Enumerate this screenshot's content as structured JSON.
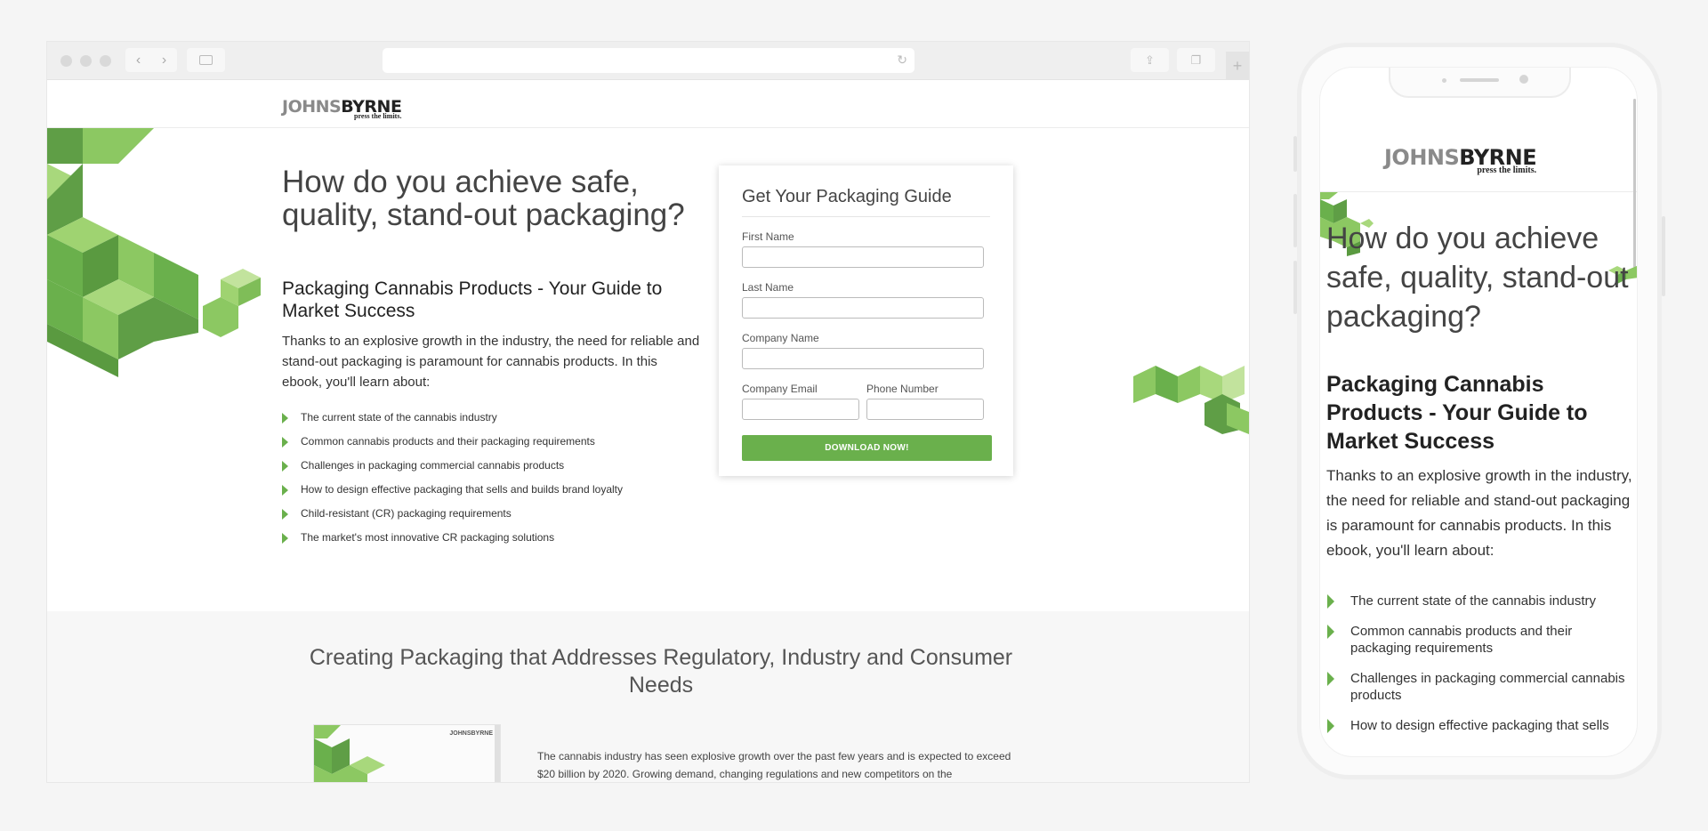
{
  "brand": {
    "name_part1": "JOHNS",
    "name_part2": "BYRNE",
    "tagline": "press the limits.",
    "accent": "#6ab04c"
  },
  "browser_icons": {
    "back": "chevron-left-icon",
    "forward": "chevron-right-icon",
    "sidebar": "sidebar-icon",
    "reload": "reload-icon",
    "share": "share-icon",
    "tabs": "tabs-icon",
    "new_tab": "plus-icon"
  },
  "hero": {
    "headline": "How do you achieve safe, quality, stand-out packaging?",
    "subheadline": "Packaging Cannabis Products - Your Guide to Market Success",
    "intro": "Thanks to an explosive growth in the industry, the need for reliable and stand-out packaging is paramount for cannabis products. In this ebook, you'll learn about:",
    "bullets": [
      "The current state of the cannabis industry",
      "Common cannabis products and their packaging requirements",
      "Challenges in packaging commercial cannabis products",
      "How to design effective packaging that sells and builds brand loyalty",
      "Child-resistant (CR) packaging requirements",
      "The market's most innovative CR packaging solutions"
    ]
  },
  "form": {
    "title": "Get Your Packaging Guide",
    "first_name_label": "First Name",
    "last_name_label": "Last Name",
    "company_name_label": "Company Name",
    "company_email_label": "Company Email",
    "phone_label": "Phone Number",
    "submit_label": "DOWNLOAD NOW!"
  },
  "section2": {
    "title": "Creating Packaging that Addresses Regulatory, Industry and Consumer Needs",
    "paragraph": "The cannabis industry has seen explosive growth over the past few years and is expected to exceed $20 billion by 2020. Growing demand, changing regulations and new competitors on the",
    "book_logo": "JOHNSBYRNE"
  },
  "mobile": {
    "headline": "How do you achieve safe, quality, stand-out packaging?",
    "subheadline": "Packaging Cannabis Products - Your Guide to Market Success",
    "intro": "Thanks to an explosive growth in the industry, the need for reliable and stand-out packaging is paramount for cannabis products. In this ebook, you'll learn about:",
    "bullets": [
      "The current state of the cannabis industry",
      "Common cannabis products and their packaging requirements",
      "Challenges in packaging commercial cannabis products",
      "How to design effective packaging that sells"
    ]
  }
}
